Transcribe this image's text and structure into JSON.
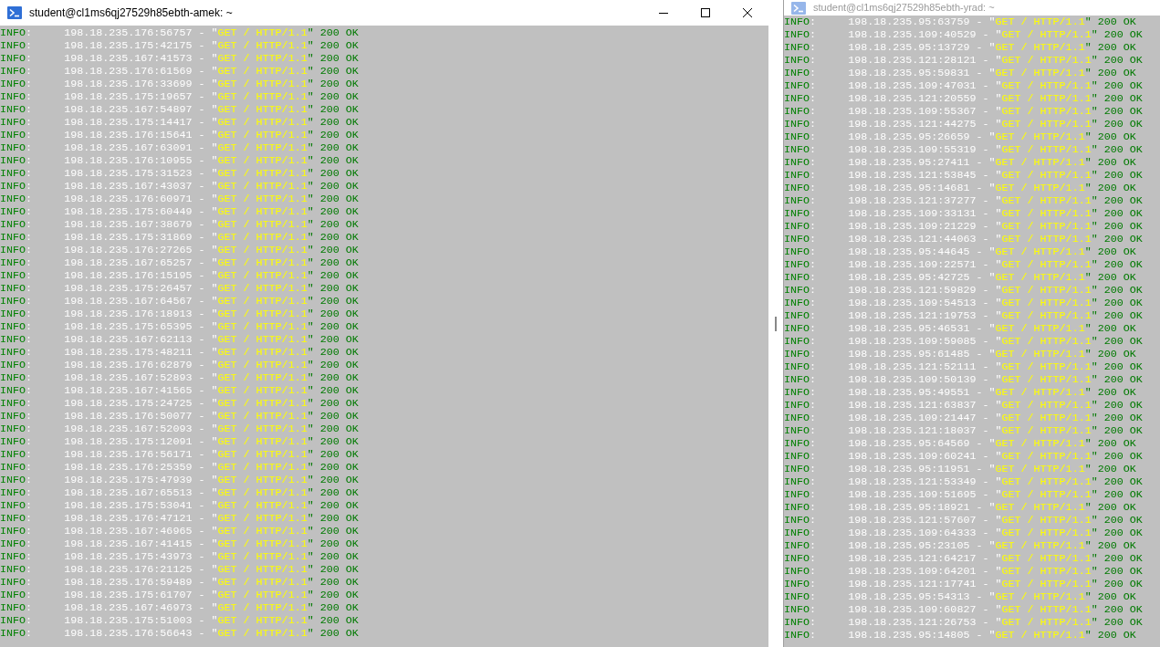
{
  "windows": [
    {
      "title": "student@cl1ms6qj27529h85ebth-amek: ~",
      "active": true,
      "lines": [
        {
          "level": "INFO",
          "address": ":     198.18.235.176:56757 - \"",
          "request": "GET / HTTP/1.1",
          "status": "\" 200 OK"
        },
        {
          "level": "INFO",
          "address": ":     198.18.235.175:42175 - \"",
          "request": "GET / HTTP/1.1",
          "status": "\" 200 OK"
        },
        {
          "level": "INFO",
          "address": ":     198.18.235.167:41573 - \"",
          "request": "GET / HTTP/1.1",
          "status": "\" 200 OK"
        },
        {
          "level": "INFO",
          "address": ":     198.18.235.176:61569 - \"",
          "request": "GET / HTTP/1.1",
          "status": "\" 200 OK"
        },
        {
          "level": "INFO",
          "address": ":     198.18.235.176:33699 - \"",
          "request": "GET / HTTP/1.1",
          "status": "\" 200 OK"
        },
        {
          "level": "INFO",
          "address": ":     198.18.235.175:19657 - \"",
          "request": "GET / HTTP/1.1",
          "status": "\" 200 OK"
        },
        {
          "level": "INFO",
          "address": ":     198.18.235.167:54897 - \"",
          "request": "GET / HTTP/1.1",
          "status": "\" 200 OK"
        },
        {
          "level": "INFO",
          "address": ":     198.18.235.175:14417 - \"",
          "request": "GET / HTTP/1.1",
          "status": "\" 200 OK"
        },
        {
          "level": "INFO",
          "address": ":     198.18.235.176:15641 - \"",
          "request": "GET / HTTP/1.1",
          "status": "\" 200 OK"
        },
        {
          "level": "INFO",
          "address": ":     198.18.235.167:63091 - \"",
          "request": "GET / HTTP/1.1",
          "status": "\" 200 OK"
        },
        {
          "level": "INFO",
          "address": ":     198.18.235.176:10955 - \"",
          "request": "GET / HTTP/1.1",
          "status": "\" 200 OK"
        },
        {
          "level": "INFO",
          "address": ":     198.18.235.175:31523 - \"",
          "request": "GET / HTTP/1.1",
          "status": "\" 200 OK"
        },
        {
          "level": "INFO",
          "address": ":     198.18.235.167:43037 - \"",
          "request": "GET / HTTP/1.1",
          "status": "\" 200 OK"
        },
        {
          "level": "INFO",
          "address": ":     198.18.235.176:60971 - \"",
          "request": "GET / HTTP/1.1",
          "status": "\" 200 OK"
        },
        {
          "level": "INFO",
          "address": ":     198.18.235.175:60449 - \"",
          "request": "GET / HTTP/1.1",
          "status": "\" 200 OK"
        },
        {
          "level": "INFO",
          "address": ":     198.18.235.167:38679 - \"",
          "request": "GET / HTTP/1.1",
          "status": "\" 200 OK"
        },
        {
          "level": "INFO",
          "address": ":     198.18.235.175:31869 - \"",
          "request": "GET / HTTP/1.1",
          "status": "\" 200 OK"
        },
        {
          "level": "INFO",
          "address": ":     198.18.235.176:27265 - \"",
          "request": "GET / HTTP/1.1",
          "status": "\" 200 OK"
        },
        {
          "level": "INFO",
          "address": ":     198.18.235.167:65257 - \"",
          "request": "GET / HTTP/1.1",
          "status": "\" 200 OK"
        },
        {
          "level": "INFO",
          "address": ":     198.18.235.176:15195 - \"",
          "request": "GET / HTTP/1.1",
          "status": "\" 200 OK"
        },
        {
          "level": "INFO",
          "address": ":     198.18.235.175:26457 - \"",
          "request": "GET / HTTP/1.1",
          "status": "\" 200 OK"
        },
        {
          "level": "INFO",
          "address": ":     198.18.235.167:64567 - \"",
          "request": "GET / HTTP/1.1",
          "status": "\" 200 OK"
        },
        {
          "level": "INFO",
          "address": ":     198.18.235.176:18913 - \"",
          "request": "GET / HTTP/1.1",
          "status": "\" 200 OK"
        },
        {
          "level": "INFO",
          "address": ":     198.18.235.175:65395 - \"",
          "request": "GET / HTTP/1.1",
          "status": "\" 200 OK"
        },
        {
          "level": "INFO",
          "address": ":     198.18.235.167:62113 - \"",
          "request": "GET / HTTP/1.1",
          "status": "\" 200 OK"
        },
        {
          "level": "INFO",
          "address": ":     198.18.235.175:48211 - \"",
          "request": "GET / HTTP/1.1",
          "status": "\" 200 OK"
        },
        {
          "level": "INFO",
          "address": ":     198.18.235.176:62879 - \"",
          "request": "GET / HTTP/1.1",
          "status": "\" 200 OK"
        },
        {
          "level": "INFO",
          "address": ":     198.18.235.167:52893 - \"",
          "request": "GET / HTTP/1.1",
          "status": "\" 200 OK"
        },
        {
          "level": "INFO",
          "address": ":     198.18.235.167:41565 - \"",
          "request": "GET / HTTP/1.1",
          "status": "\" 200 OK"
        },
        {
          "level": "INFO",
          "address": ":     198.18.235.175:24725 - \"",
          "request": "GET / HTTP/1.1",
          "status": "\" 200 OK"
        },
        {
          "level": "INFO",
          "address": ":     198.18.235.176:50077 - \"",
          "request": "GET / HTTP/1.1",
          "status": "\" 200 OK"
        },
        {
          "level": "INFO",
          "address": ":     198.18.235.167:52093 - \"",
          "request": "GET / HTTP/1.1",
          "status": "\" 200 OK"
        },
        {
          "level": "INFO",
          "address": ":     198.18.235.175:12091 - \"",
          "request": "GET / HTTP/1.1",
          "status": "\" 200 OK"
        },
        {
          "level": "INFO",
          "address": ":     198.18.235.176:56171 - \"",
          "request": "GET / HTTP/1.1",
          "status": "\" 200 OK"
        },
        {
          "level": "INFO",
          "address": ":     198.18.235.176:25359 - \"",
          "request": "GET / HTTP/1.1",
          "status": "\" 200 OK"
        },
        {
          "level": "INFO",
          "address": ":     198.18.235.175:47939 - \"",
          "request": "GET / HTTP/1.1",
          "status": "\" 200 OK"
        },
        {
          "level": "INFO",
          "address": ":     198.18.235.167:65513 - \"",
          "request": "GET / HTTP/1.1",
          "status": "\" 200 OK"
        },
        {
          "level": "INFO",
          "address": ":     198.18.235.175:53041 - \"",
          "request": "GET / HTTP/1.1",
          "status": "\" 200 OK"
        },
        {
          "level": "INFO",
          "address": ":     198.18.235.176:47121 - \"",
          "request": "GET / HTTP/1.1",
          "status": "\" 200 OK"
        },
        {
          "level": "INFO",
          "address": ":     198.18.235.167:46965 - \"",
          "request": "GET / HTTP/1.1",
          "status": "\" 200 OK"
        },
        {
          "level": "INFO",
          "address": ":     198.18.235.167:41415 - \"",
          "request": "GET / HTTP/1.1",
          "status": "\" 200 OK"
        },
        {
          "level": "INFO",
          "address": ":     198.18.235.175:43973 - \"",
          "request": "GET / HTTP/1.1",
          "status": "\" 200 OK"
        },
        {
          "level": "INFO",
          "address": ":     198.18.235.176:21125 - \"",
          "request": "GET / HTTP/1.1",
          "status": "\" 200 OK"
        },
        {
          "level": "INFO",
          "address": ":     198.18.235.176:59489 - \"",
          "request": "GET / HTTP/1.1",
          "status": "\" 200 OK"
        },
        {
          "level": "INFO",
          "address": ":     198.18.235.175:61707 - \"",
          "request": "GET / HTTP/1.1",
          "status": "\" 200 OK"
        },
        {
          "level": "INFO",
          "address": ":     198.18.235.167:46973 - \"",
          "request": "GET / HTTP/1.1",
          "status": "\" 200 OK"
        },
        {
          "level": "INFO",
          "address": ":     198.18.235.175:51003 - \"",
          "request": "GET / HTTP/1.1",
          "status": "\" 200 OK"
        },
        {
          "level": "INFO",
          "address": ":     198.18.235.176:56643 - \"",
          "request": "GET / HTTP/1.1",
          "status": "\" 200 OK"
        }
      ]
    },
    {
      "title": "student@cl1ms6qj27529h85ebth-yrad: ~",
      "active": false,
      "lines": [
        {
          "level": "INFO",
          "address": ":     198.18.235.95:63759 - \"",
          "request": "GET / HTTP/1.1",
          "status": "\" 200 OK"
        },
        {
          "level": "INFO",
          "address": ":     198.18.235.109:40529 - \"",
          "request": "GET / HTTP/1.1",
          "status": "\" 200 OK"
        },
        {
          "level": "INFO",
          "address": ":     198.18.235.95:13729 - \"",
          "request": "GET / HTTP/1.1",
          "status": "\" 200 OK"
        },
        {
          "level": "INFO",
          "address": ":     198.18.235.121:28121 - \"",
          "request": "GET / HTTP/1.1",
          "status": "\" 200 OK"
        },
        {
          "level": "INFO",
          "address": ":     198.18.235.95:59831 - \"",
          "request": "GET / HTTP/1.1",
          "status": "\" 200 OK"
        },
        {
          "level": "INFO",
          "address": ":     198.18.235.109:47031 - \"",
          "request": "GET / HTTP/1.1",
          "status": "\" 200 OK"
        },
        {
          "level": "INFO",
          "address": ":     198.18.235.121:20559 - \"",
          "request": "GET / HTTP/1.1",
          "status": "\" 200 OK"
        },
        {
          "level": "INFO",
          "address": ":     198.18.235.109:55367 - \"",
          "request": "GET / HTTP/1.1",
          "status": "\" 200 OK"
        },
        {
          "level": "INFO",
          "address": ":     198.18.235.121:44275 - \"",
          "request": "GET / HTTP/1.1",
          "status": "\" 200 OK"
        },
        {
          "level": "INFO",
          "address": ":     198.18.235.95:26659 - \"",
          "request": "GET / HTTP/1.1",
          "status": "\" 200 OK"
        },
        {
          "level": "INFO",
          "address": ":     198.18.235.109:55319 - \"",
          "request": "GET / HTTP/1.1",
          "status": "\" 200 OK"
        },
        {
          "level": "INFO",
          "address": ":     198.18.235.95:27411 - \"",
          "request": "GET / HTTP/1.1",
          "status": "\" 200 OK"
        },
        {
          "level": "INFO",
          "address": ":     198.18.235.121:53845 - \"",
          "request": "GET / HTTP/1.1",
          "status": "\" 200 OK"
        },
        {
          "level": "INFO",
          "address": ":     198.18.235.95:14681 - \"",
          "request": "GET / HTTP/1.1",
          "status": "\" 200 OK"
        },
        {
          "level": "INFO",
          "address": ":     198.18.235.121:37277 - \"",
          "request": "GET / HTTP/1.1",
          "status": "\" 200 OK"
        },
        {
          "level": "INFO",
          "address": ":     198.18.235.109:33131 - \"",
          "request": "GET / HTTP/1.1",
          "status": "\" 200 OK"
        },
        {
          "level": "INFO",
          "address": ":     198.18.235.109:21229 - \"",
          "request": "GET / HTTP/1.1",
          "status": "\" 200 OK"
        },
        {
          "level": "INFO",
          "address": ":     198.18.235.121:44063 - \"",
          "request": "GET / HTTP/1.1",
          "status": "\" 200 OK"
        },
        {
          "level": "INFO",
          "address": ":     198.18.235.95:44645 - \"",
          "request": "GET / HTTP/1.1",
          "status": "\" 200 OK"
        },
        {
          "level": "INFO",
          "address": ":     198.18.235.109:22571 - \"",
          "request": "GET / HTTP/1.1",
          "status": "\" 200 OK"
        },
        {
          "level": "INFO",
          "address": ":     198.18.235.95:42725 - \"",
          "request": "GET / HTTP/1.1",
          "status": "\" 200 OK"
        },
        {
          "level": "INFO",
          "address": ":     198.18.235.121:59829 - \"",
          "request": "GET / HTTP/1.1",
          "status": "\" 200 OK"
        },
        {
          "level": "INFO",
          "address": ":     198.18.235.109:54513 - \"",
          "request": "GET / HTTP/1.1",
          "status": "\" 200 OK"
        },
        {
          "level": "INFO",
          "address": ":     198.18.235.121:19753 - \"",
          "request": "GET / HTTP/1.1",
          "status": "\" 200 OK"
        },
        {
          "level": "INFO",
          "address": ":     198.18.235.95:46531 - \"",
          "request": "GET / HTTP/1.1",
          "status": "\" 200 OK"
        },
        {
          "level": "INFO",
          "address": ":     198.18.235.109:59085 - \"",
          "request": "GET / HTTP/1.1",
          "status": "\" 200 OK"
        },
        {
          "level": "INFO",
          "address": ":     198.18.235.95:61485 - \"",
          "request": "GET / HTTP/1.1",
          "status": "\" 200 OK"
        },
        {
          "level": "INFO",
          "address": ":     198.18.235.121:52111 - \"",
          "request": "GET / HTTP/1.1",
          "status": "\" 200 OK"
        },
        {
          "level": "INFO",
          "address": ":     198.18.235.109:50139 - \"",
          "request": "GET / HTTP/1.1",
          "status": "\" 200 OK"
        },
        {
          "level": "INFO",
          "address": ":     198.18.235.95:49551 - \"",
          "request": "GET / HTTP/1.1",
          "status": "\" 200 OK"
        },
        {
          "level": "INFO",
          "address": ":     198.18.235.121:63837 - \"",
          "request": "GET / HTTP/1.1",
          "status": "\" 200 OK"
        },
        {
          "level": "INFO",
          "address": ":     198.18.235.109:21447 - \"",
          "request": "GET / HTTP/1.1",
          "status": "\" 200 OK"
        },
        {
          "level": "INFO",
          "address": ":     198.18.235.121:18037 - \"",
          "request": "GET / HTTP/1.1",
          "status": "\" 200 OK"
        },
        {
          "level": "INFO",
          "address": ":     198.18.235.95:64569 - \"",
          "request": "GET / HTTP/1.1",
          "status": "\" 200 OK"
        },
        {
          "level": "INFO",
          "address": ":     198.18.235.109:60241 - \"",
          "request": "GET / HTTP/1.1",
          "status": "\" 200 OK"
        },
        {
          "level": "INFO",
          "address": ":     198.18.235.95:11951 - \"",
          "request": "GET / HTTP/1.1",
          "status": "\" 200 OK"
        },
        {
          "level": "INFO",
          "address": ":     198.18.235.121:53349 - \"",
          "request": "GET / HTTP/1.1",
          "status": "\" 200 OK"
        },
        {
          "level": "INFO",
          "address": ":     198.18.235.109:51695 - \"",
          "request": "GET / HTTP/1.1",
          "status": "\" 200 OK"
        },
        {
          "level": "INFO",
          "address": ":     198.18.235.95:18921 - \"",
          "request": "GET / HTTP/1.1",
          "status": "\" 200 OK"
        },
        {
          "level": "INFO",
          "address": ":     198.18.235.121:57607 - \"",
          "request": "GET / HTTP/1.1",
          "status": "\" 200 OK"
        },
        {
          "level": "INFO",
          "address": ":     198.18.235.109:64333 - \"",
          "request": "GET / HTTP/1.1",
          "status": "\" 200 OK"
        },
        {
          "level": "INFO",
          "address": ":     198.18.235.95:23105 - \"",
          "request": "GET / HTTP/1.1",
          "status": "\" 200 OK"
        },
        {
          "level": "INFO",
          "address": ":     198.18.235.121:64217 - \"",
          "request": "GET / HTTP/1.1",
          "status": "\" 200 OK"
        },
        {
          "level": "INFO",
          "address": ":     198.18.235.109:64201 - \"",
          "request": "GET / HTTP/1.1",
          "status": "\" 200 OK"
        },
        {
          "level": "INFO",
          "address": ":     198.18.235.121:17741 - \"",
          "request": "GET / HTTP/1.1",
          "status": "\" 200 OK"
        },
        {
          "level": "INFO",
          "address": ":     198.18.235.95:54313 - \"",
          "request": "GET / HTTP/1.1",
          "status": "\" 200 OK"
        },
        {
          "level": "INFO",
          "address": ":     198.18.235.109:60827 - \"",
          "request": "GET / HTTP/1.1",
          "status": "\" 200 OK"
        },
        {
          "level": "INFO",
          "address": ":     198.18.235.121:26753 - \"",
          "request": "GET / HTTP/1.1",
          "status": "\" 200 OK"
        },
        {
          "level": "INFO",
          "address": ":     198.18.235.95:14805 - \"",
          "request": "GET / HTTP/1.1",
          "status": "\" 200 OK"
        }
      ]
    }
  ]
}
